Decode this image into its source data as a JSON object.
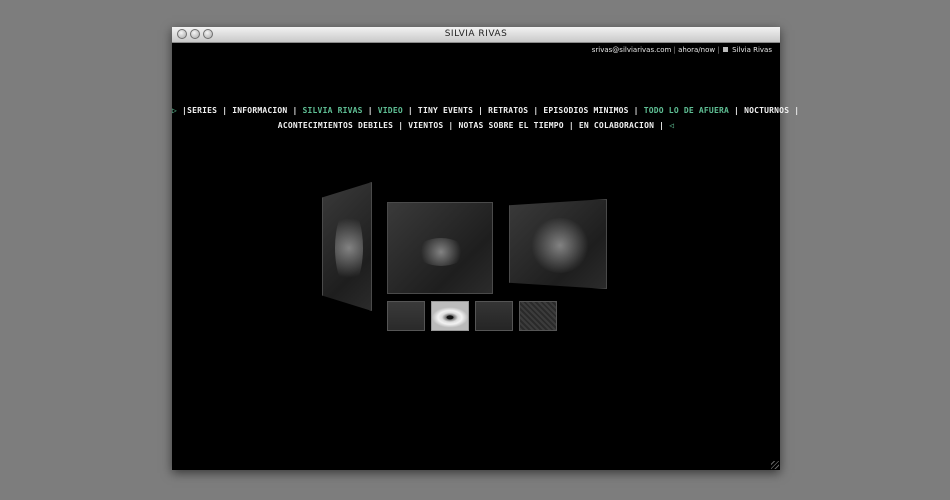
{
  "window": {
    "title": "SILVIA RIVAS"
  },
  "toplinks": {
    "email": "srivas@silviarivas.com",
    "ahora": "ahora/now",
    "name": "Silvia Rivas"
  },
  "nav": {
    "start_arrow": "▷",
    "end_arrow": "◁",
    "row1": [
      {
        "label": "SERIES",
        "active": false
      },
      {
        "label": "INFORMACION",
        "active": false
      },
      {
        "label": "SILVIA RIVAS",
        "active": true
      },
      {
        "label": "VIDEO",
        "active": true
      },
      {
        "label": "TINY EVENTS",
        "active": false
      },
      {
        "label": "RETRATOS",
        "active": false
      },
      {
        "label": "EPISODIOS MINIMOS",
        "active": false
      },
      {
        "label": "TODO LO DE AFUERA",
        "active": true
      },
      {
        "label": "NOCTURNOS",
        "active": false
      }
    ],
    "row2": [
      {
        "label": "ACONTECIMIENTOS DEBILES",
        "active": false
      },
      {
        "label": "VIENTOS",
        "active": false
      },
      {
        "label": "NOTAS SOBRE EL TIEMPO",
        "active": false
      },
      {
        "label": "EN COLABORACION",
        "active": false
      }
    ]
  },
  "colors": {
    "accent": "#5fbf94",
    "background": "#000000"
  },
  "gallery": {
    "panels": [
      "left-panel",
      "center-panel",
      "right-panel"
    ],
    "thumbnails": [
      "thumb-1",
      "thumb-2-eye",
      "thumb-3",
      "thumb-4"
    ]
  }
}
